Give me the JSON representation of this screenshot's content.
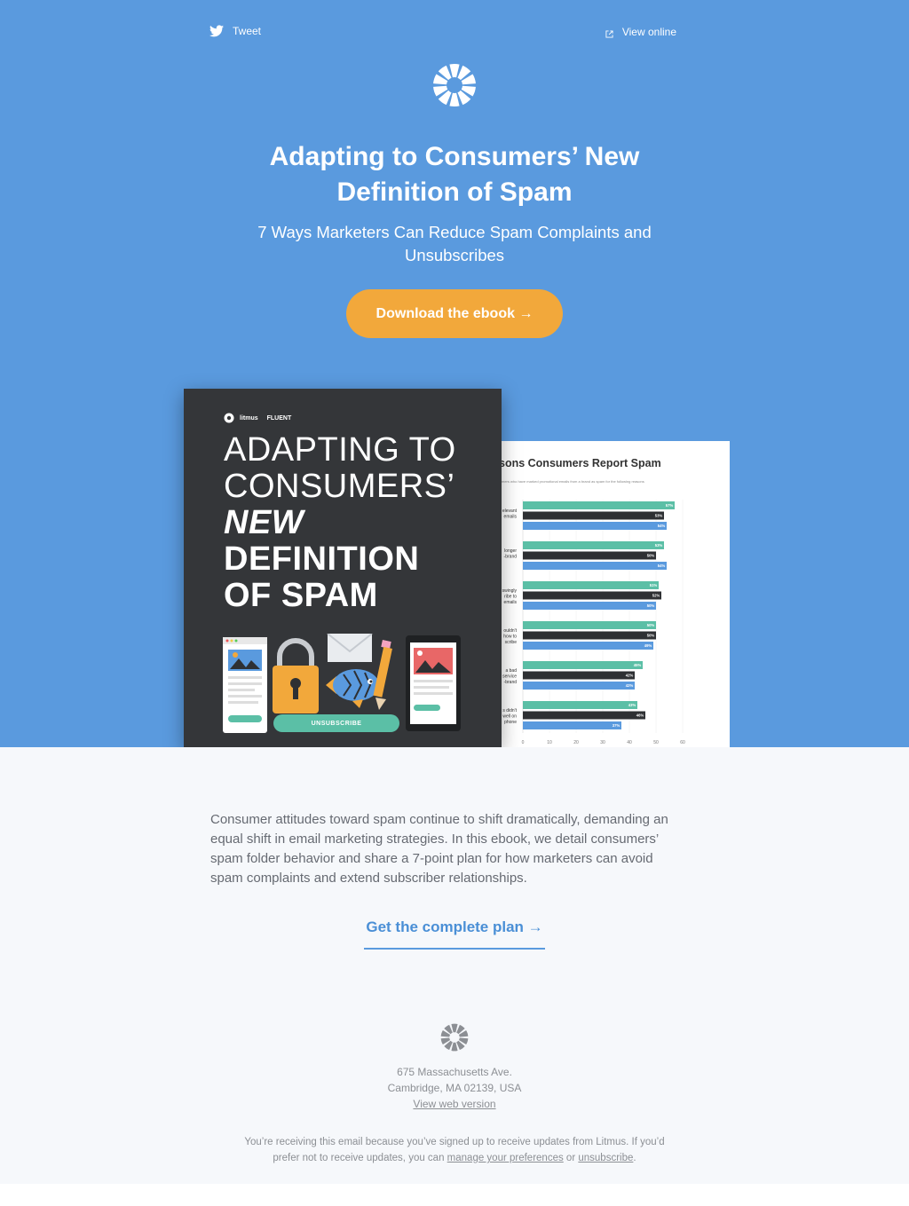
{
  "topbar": {
    "tweet_label": "Tweet",
    "view_online_label": "View online"
  },
  "hero": {
    "title_line1": "Adapting to Consumers’ New",
    "title_line2": "Definition of Spam",
    "subtitle_line1": "7 Ways Marketers Can Reduce Spam Complaints and",
    "subtitle_line2": "Unsubscribes",
    "cta_label": "Download the ebook →",
    "background_color": "#5a9ade",
    "cta_color": "#f2a83b"
  },
  "cover": {
    "brand1": "litmus",
    "brand2": "FLUENT",
    "title_line1": "ADAPTING TO",
    "title_line2": "CONSUMERS’",
    "title_line3": "NEW",
    "title_line4": "DEFINITION",
    "title_line5": "OF SPAM",
    "unsubscribe_label": "UNSUBSCRIBE"
  },
  "chart_preview": {
    "title": "sons Consumers Report Spam",
    "subtitle": "mers who have marked promotional emails from a brand as spam for the following reasons",
    "chart_data": {
      "type": "bar",
      "orientation": "horizontal",
      "title": "sons Consumers Report Spam",
      "x_ticks": [
        "0",
        "10",
        "20",
        "30",
        "40",
        "50",
        "60"
      ],
      "xlim": [
        0,
        60
      ],
      "categories": [
        [
          "elevant",
          "emails"
        ],
        [
          "longer",
          "-brand"
        ],
        [
          "swingly",
          "ribe to",
          "emails"
        ],
        [
          "ouldn't",
          "how to",
          "scribe"
        ],
        [
          "a bad",
          "service",
          "-brand"
        ],
        [
          "s didn't",
          "well on",
          "phone"
        ]
      ],
      "series": [
        {
          "color": "#5bbfa6",
          "values": [
            57,
            53,
            51,
            50,
            45,
            43
          ]
        },
        {
          "color": "#2e3033",
          "values": [
            53,
            50,
            52,
            50,
            42,
            46
          ]
        },
        {
          "color": "#5a9ade",
          "values": [
            54,
            54,
            50,
            49,
            42,
            37
          ]
        }
      ],
      "labels": [
        [
          "57%",
          "53%",
          "54%"
        ],
        [
          "53%",
          "50%",
          "54%"
        ],
        [
          "51%",
          "52%",
          "50%"
        ],
        [
          "50%",
          "50%",
          "49%"
        ],
        [
          "45%",
          "42%",
          "42%"
        ],
        [
          "43%",
          "46%",
          "37%"
        ]
      ]
    }
  },
  "content": {
    "body_line1": "Consumer attitudes toward spam continue to shift dramatically, demanding an",
    "body_line2": "equal shift in email marketing strategies. In this ebook, we detail consumers’",
    "body_line3": "spam folder behavior and share a 7-point plan for how marketers can avoid",
    "body_line4": "spam complaints and extend subscriber relationships.",
    "plan_link_label": "Get the complete plan →"
  },
  "footer": {
    "address_line1": "675 Massachusetts Ave.",
    "address_line2": "Cambridge, MA 02139, USA",
    "web_version_label": "View web version",
    "notice_part1": "You’re receiving this email because you’ve signed up to receive updates from Litmus. If you’d",
    "notice_part2": "prefer not to receive updates, you can ",
    "manage_preferences_label": "manage your preferences",
    "notice_or": " or ",
    "unsubscribe_label": "unsubscribe",
    "notice_end": "."
  }
}
